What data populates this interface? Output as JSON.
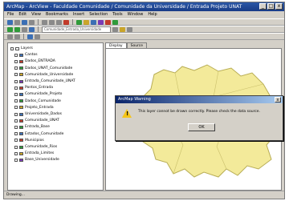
{
  "window": {
    "title": "ArcMap - ArcView - Faculdade Comunidade / Comunidade da Universidade / Entrada Projeto UNAT",
    "title_buttons": [
      "_",
      "□",
      "x"
    ]
  },
  "menubar": {
    "items": [
      "File",
      "Edit",
      "View",
      "Bookmarks",
      "Insert",
      "Selection",
      "Tools",
      "Window",
      "Help"
    ]
  },
  "toolbar": {
    "layer_combo": "Comunidade_Entrada_Universidade"
  },
  "toc": {
    "items": [
      {
        "label": "Layers",
        "color": "#ffffff"
      },
      {
        "label": "Cantos",
        "color": "#3b6fb5"
      },
      {
        "label": "Dados_ENTRADA",
        "color": "#c23b2b"
      },
      {
        "label": "Dados_UNAT_Comunidade",
        "color": "#2f9b3a"
      },
      {
        "label": "Comunidade_Universidade",
        "color": "#caa52a"
      },
      {
        "label": "Entrada_Comunidade_UNAT",
        "color": "#7a3bb5"
      },
      {
        "label": "Pontos_Entrada",
        "color": "#c23b2b"
      },
      {
        "label": "Comunidade_Projeto",
        "color": "#3b6fb5"
      },
      {
        "label": "Dados_Comunidade",
        "color": "#2f9b3a"
      },
      {
        "label": "Projeto_Entrada",
        "color": "#caa52a"
      },
      {
        "label": "Universidade_Dados",
        "color": "#3b6fb5"
      },
      {
        "label": "Comunidade_UNAT",
        "color": "#c23b2b"
      },
      {
        "label": "Entrada_Base",
        "color": "#2f9b3a"
      },
      {
        "label": "Estados_Comunidade",
        "color": "#3b6fb5"
      },
      {
        "label": "Municipios",
        "color": "#c23b2b"
      },
      {
        "label": "Comunidade_Rios",
        "color": "#2f9b3a"
      },
      {
        "label": "Entrada_Limites",
        "color": "#caa52a"
      },
      {
        "label": "Base_Universidade",
        "color": "#7a3bb5"
      }
    ]
  },
  "tabs": [
    "Display",
    "Source"
  ],
  "map": {
    "fill_color": "#f3ea9a"
  },
  "dialog": {
    "title": "ArcMap Warning",
    "message": "This layer cannot be drawn correctly. Please check the data source.",
    "ok_label": "OK",
    "close_label": "x"
  },
  "statusbar": {
    "text": "Drawing..."
  }
}
